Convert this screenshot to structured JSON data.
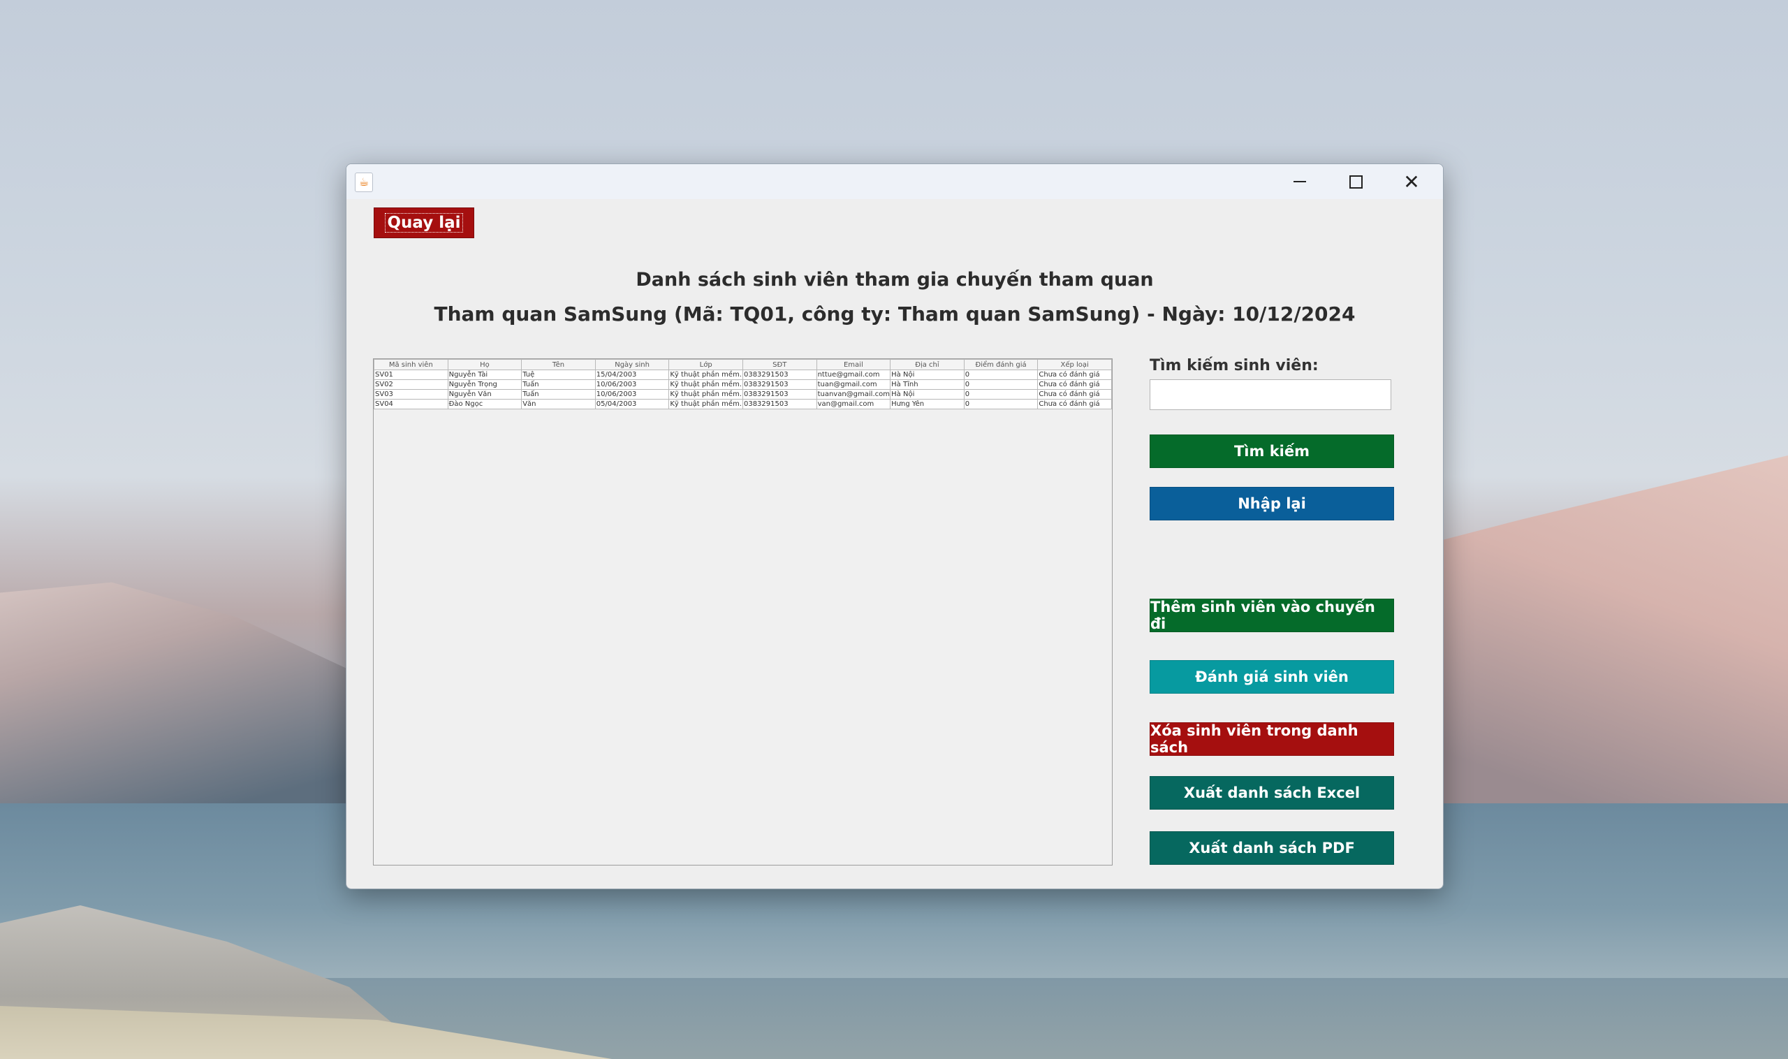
{
  "window": {
    "back_label": "Quay lại",
    "title_line1": "Danh sách sinh viên tham gia chuyến tham quan",
    "title_line2": "Tham quan SamSung (Mã: TQ01, công ty: Tham quan SamSung) - Ngày: 10/12/2024"
  },
  "table": {
    "columns": [
      "Mã sinh viên",
      "Họ",
      "Tên",
      "Ngày sinh",
      "Lớp",
      "SĐT",
      "Email",
      "Địa chỉ",
      "Điểm đánh giá",
      "Xếp loại"
    ],
    "rows": [
      [
        "SV01",
        "Nguyễn Tài",
        "Tuệ",
        "15/04/2003",
        "Kỹ thuật phần mềm...",
        "0383291503",
        "nttue@gmail.com",
        "Hà Nội",
        "0",
        "Chưa có đánh giá"
      ],
      [
        "SV02",
        "Nguyễn Trọng",
        "Tuấn",
        "10/06/2003",
        "Kỹ thuật phần mềm...",
        "0383291503",
        "tuan@gmail.com",
        "Hà Tĩnh",
        "0",
        "Chưa có đánh giá"
      ],
      [
        "SV03",
        "Nguyễn Văn",
        "Tuấn",
        "10/06/2003",
        "Kỹ thuật phần mềm...",
        "0383291503",
        "tuanvan@gmail.com",
        "Hà Nội",
        "0",
        "Chưa có đánh giá"
      ],
      [
        "SV04",
        "Đào Ngọc",
        "Văn",
        "05/04/2003",
        "Kỹ thuật phần mềm...",
        "0383291503",
        "van@gmail.com",
        "Hưng Yên",
        "0",
        "Chưa có đánh giá"
      ]
    ]
  },
  "search": {
    "label": "Tìm kiếm sinh viên:",
    "value": ""
  },
  "buttons": {
    "search": "Tìm kiếm",
    "reset": "Nhập lại",
    "add": "Thêm sinh viên vào chuyến đi",
    "evaluate": "Đánh giá sinh viên",
    "delete": "Xóa sinh viên trong danh sách",
    "export_excel": "Xuất danh sách Excel",
    "export_pdf": "Xuất danh sách PDF"
  },
  "colors": {
    "back_button": "#a50f0f",
    "search_button": "#056b2a",
    "reset_button": "#0a5f9a",
    "add_button": "#056b2a",
    "evaluate_button": "#079aa0",
    "delete_button": "#a50f0f",
    "export_buttons": "#06685f"
  },
  "icons": {
    "app": "java-icon",
    "minimize": "minimize-icon",
    "maximize": "maximize-icon",
    "close": "close-icon"
  }
}
